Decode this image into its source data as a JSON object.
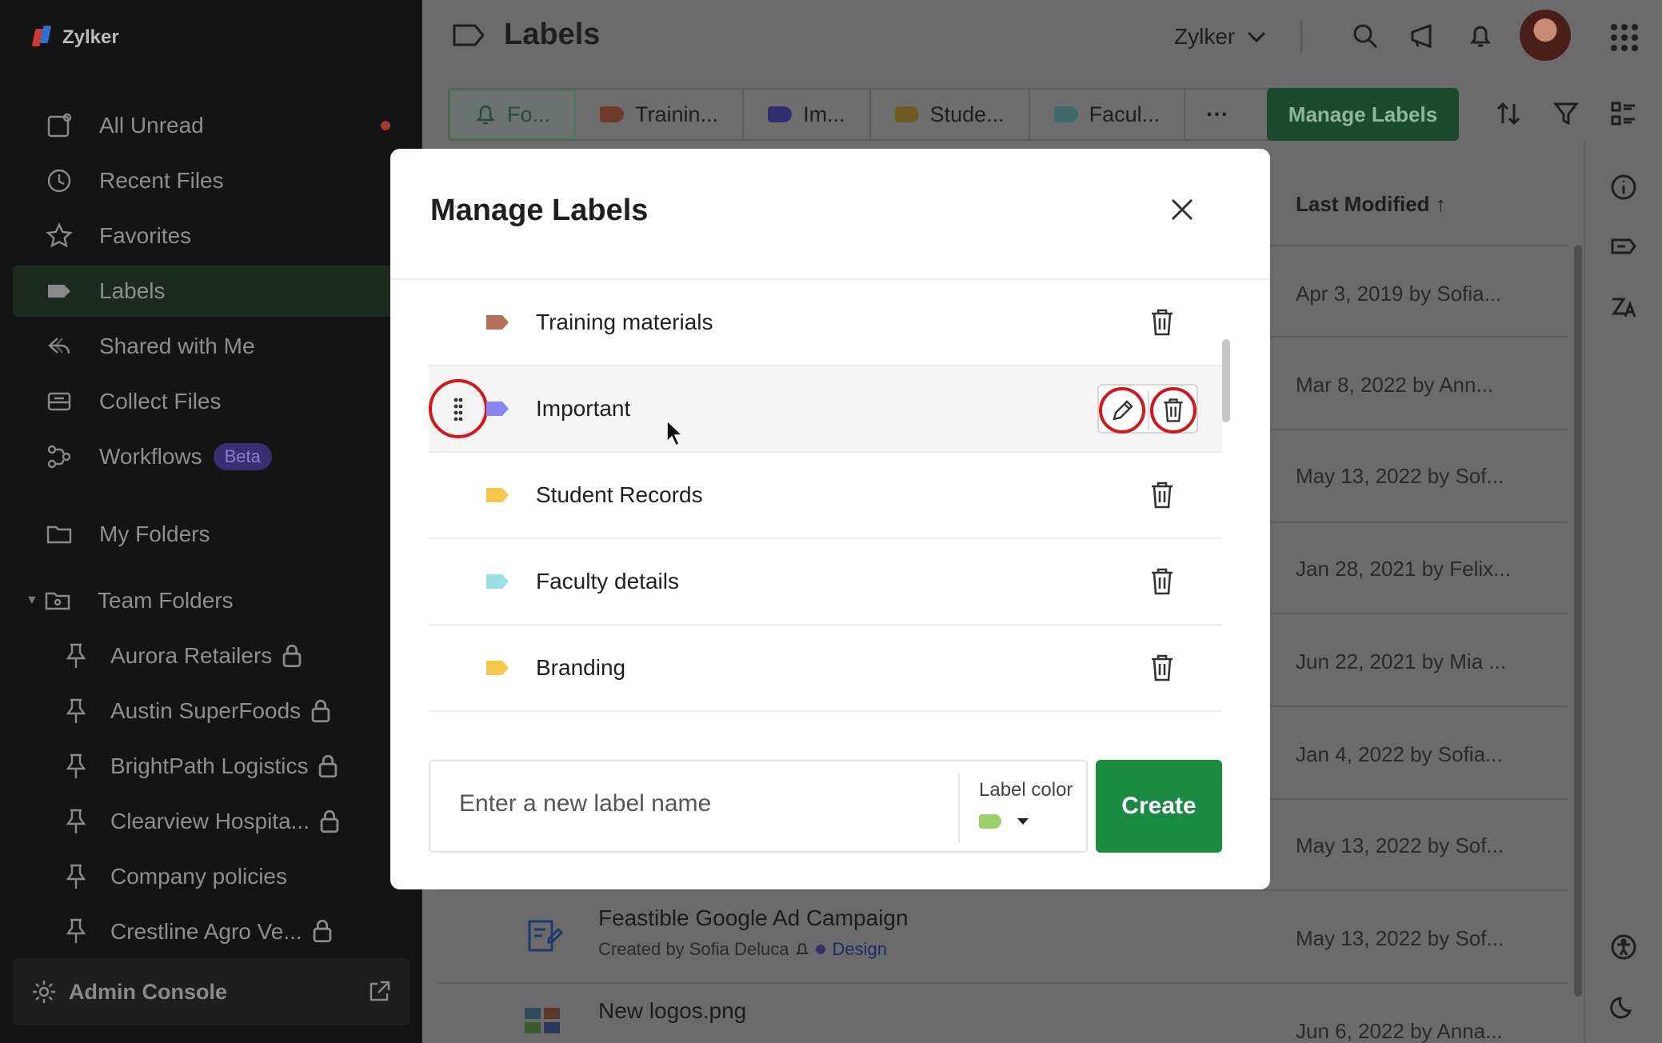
{
  "app": {
    "brand": "Zylker"
  },
  "colors": {
    "accent_green": "#1a8a40",
    "highlight_red": "#d9141c",
    "beta_purple": "#3a2e72"
  },
  "sidebar": {
    "items": [
      {
        "label": "All Unread",
        "icon": "mail-unread-icon"
      },
      {
        "label": "Recent Files",
        "icon": "clock-icon"
      },
      {
        "label": "Favorites",
        "icon": "star-icon"
      },
      {
        "label": "Labels",
        "icon": "label-icon"
      },
      {
        "label": "Shared with Me",
        "icon": "share-icon"
      },
      {
        "label": "Collect Files",
        "icon": "inbox-icon"
      },
      {
        "label": "Workflows",
        "icon": "workflow-icon",
        "badge": "Beta"
      },
      {
        "label": "My Folders",
        "icon": "folder-icon"
      },
      {
        "label": "Team Folders",
        "icon": "team-folder-icon"
      }
    ],
    "team_folders": [
      "Aurora Retailers",
      "Austin SuperFoods",
      "BrightPath Logistics",
      "Clearview Hospita...",
      "Company policies",
      "Crestline Agro Ve..."
    ],
    "admin_console": "Admin Console"
  },
  "header": {
    "title": "Labels",
    "org": "Zylker"
  },
  "tabs": [
    {
      "label": "Fo...",
      "color": "#6a7370"
    },
    {
      "label": "Trainin...",
      "color": "#6e3a2c"
    },
    {
      "label": "Im...",
      "color": "#2f2e6e"
    },
    {
      "label": "Stude...",
      "color": "#6e5a22"
    },
    {
      "label": "Facul...",
      "color": "#3d6a6a"
    }
  ],
  "tabs_more": "···",
  "manage_labels_button": "Manage Labels",
  "list": {
    "column_header": "Last Modified ↑",
    "rows": [
      {
        "modified": "Apr 3, 2019 by Sofia..."
      },
      {
        "modified": "Mar 8, 2022 by Ann..."
      },
      {
        "modified": "May 13, 2022 by Sof..."
      },
      {
        "modified": "Jan 28, 2021 by Felix..."
      },
      {
        "modified": "Jun 22, 2021 by Mia ..."
      },
      {
        "modified": "Jan 4, 2022 by Sofia..."
      },
      {
        "modified": "May 13, 2022 by Sof..."
      },
      {
        "modified": "May 13, 2022 by Sof...",
        "name": "Feastible Google Ad Campaign",
        "sub": "Created by Sofia Deluca",
        "label": "Design"
      },
      {
        "modified": "Jun 6, 2022 by Anna...",
        "name": "New logos.png"
      }
    ]
  },
  "modal": {
    "title": "Manage Labels",
    "labels": [
      {
        "name": "Training materials",
        "color": "#b96e5c"
      },
      {
        "name": "Important",
        "color": "#8d86f0"
      },
      {
        "name": "Student Records",
        "color": "#f5c84c"
      },
      {
        "name": "Faculty details",
        "color": "#9be0e6"
      },
      {
        "name": "Branding",
        "color": "#f5c84c"
      }
    ],
    "new_label_placeholder": "Enter a new label name",
    "label_color_caption": "Label color",
    "selected_color": "#9bd06a",
    "create_button": "Create"
  }
}
